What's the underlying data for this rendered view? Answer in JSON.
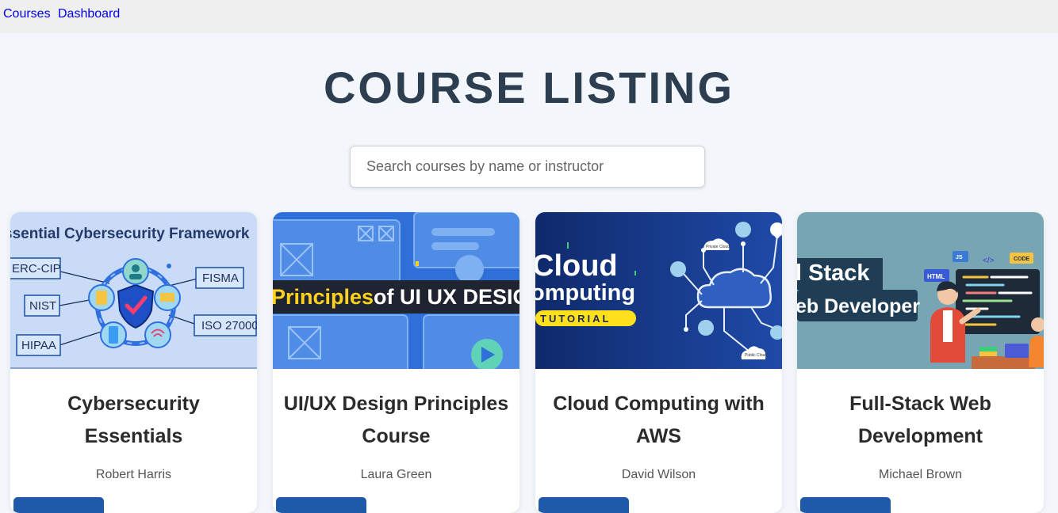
{
  "nav": {
    "courses": "Courses",
    "dashboard": "Dashboard"
  },
  "page": {
    "title": "COURSE LISTING"
  },
  "search": {
    "placeholder": "Search courses by name or instructor"
  },
  "courses": [
    {
      "title": "Cybersecurity Essentials",
      "instructor": "Robert Harris",
      "thumb": {
        "heading": "ssential Cybersecurity Framework",
        "tags": [
          "ERC-CIP",
          "NIST",
          "HIPAA",
          "FISMA",
          "ISO 27000"
        ]
      }
    },
    {
      "title": "UI/UX Design Principles Course",
      "instructor": "Laura Green",
      "thumb": {
        "banner_a": "Principles",
        "banner_b": "of UI UX DESIG"
      }
    },
    {
      "title": "Cloud Computing with AWS",
      "instructor": "David Wilson",
      "thumb": {
        "line1": "Cloud",
        "line2": "omputing",
        "tag": "TUTORIAL",
        "node_top": "Private Cloud",
        "node_bottom": "Public Cloud"
      }
    },
    {
      "title": "Full-Stack Web Development",
      "instructor": "Michael Brown",
      "thumb": {
        "line1": "l Stack",
        "line2": "eb Developer",
        "badges": [
          "JS",
          "</>",
          "CODE",
          "HTML"
        ]
      }
    }
  ]
}
